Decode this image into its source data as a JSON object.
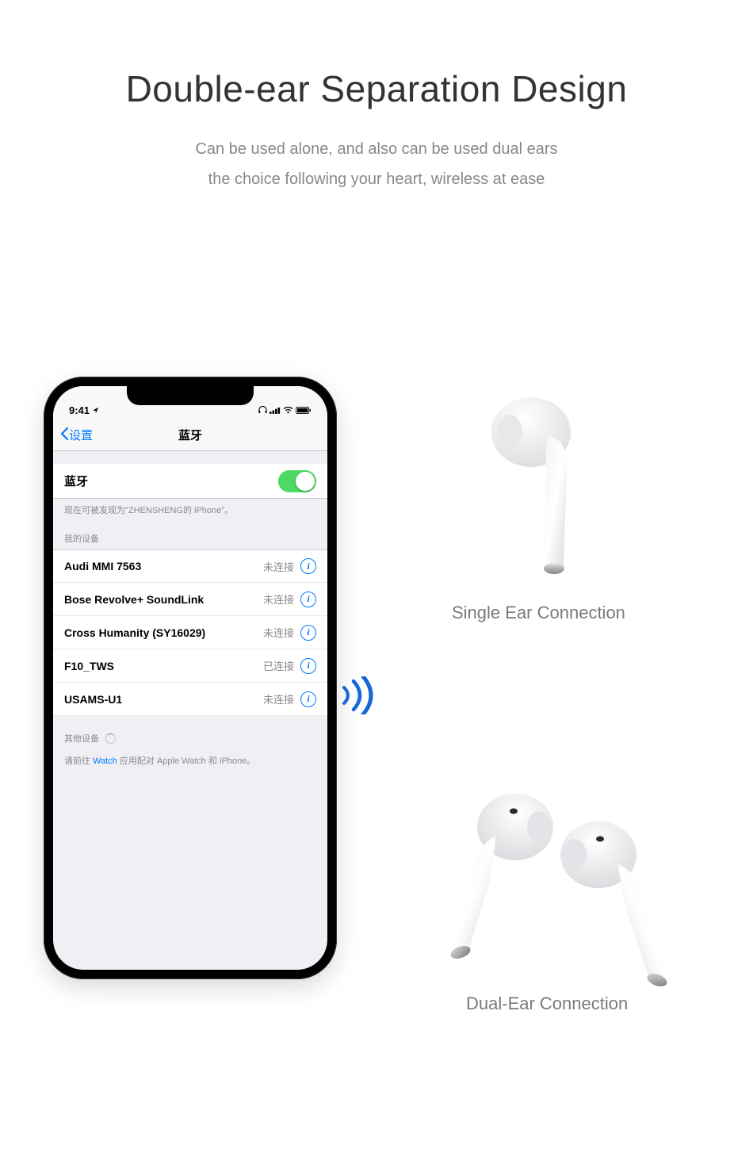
{
  "hero": {
    "title": "Double-ear Separation Design",
    "sub_line1": "Can be used alone, and also can be used dual ears",
    "sub_line2": "the choice following your heart, wireless at ease"
  },
  "phone": {
    "status_time": "9:41",
    "nav_back": "设置",
    "nav_title": "蓝牙",
    "bt_label": "蓝牙",
    "discoverable": "现在可被发现为\"ZHENSHENG的 iPhone\"。",
    "my_devices_header": "我的设备",
    "devices": [
      {
        "name": "Audi MMI 7563",
        "status": "未连接"
      },
      {
        "name": "Bose Revolve+ SoundLink",
        "status": "未连接"
      },
      {
        "name": "Cross Humanity (SY16029)",
        "status": "未连接"
      },
      {
        "name": "F10_TWS",
        "status": "已连接"
      },
      {
        "name": "USAMS-U1",
        "status": "未连接"
      }
    ],
    "other_header": "其他设备",
    "watch_note_pre": "请前往 ",
    "watch_note_link": "Watch",
    "watch_note_post": " 应用配对 Apple Watch 和 iPhone。"
  },
  "captions": {
    "single": "Single Ear Connection",
    "dual": "Dual-Ear Connection"
  }
}
